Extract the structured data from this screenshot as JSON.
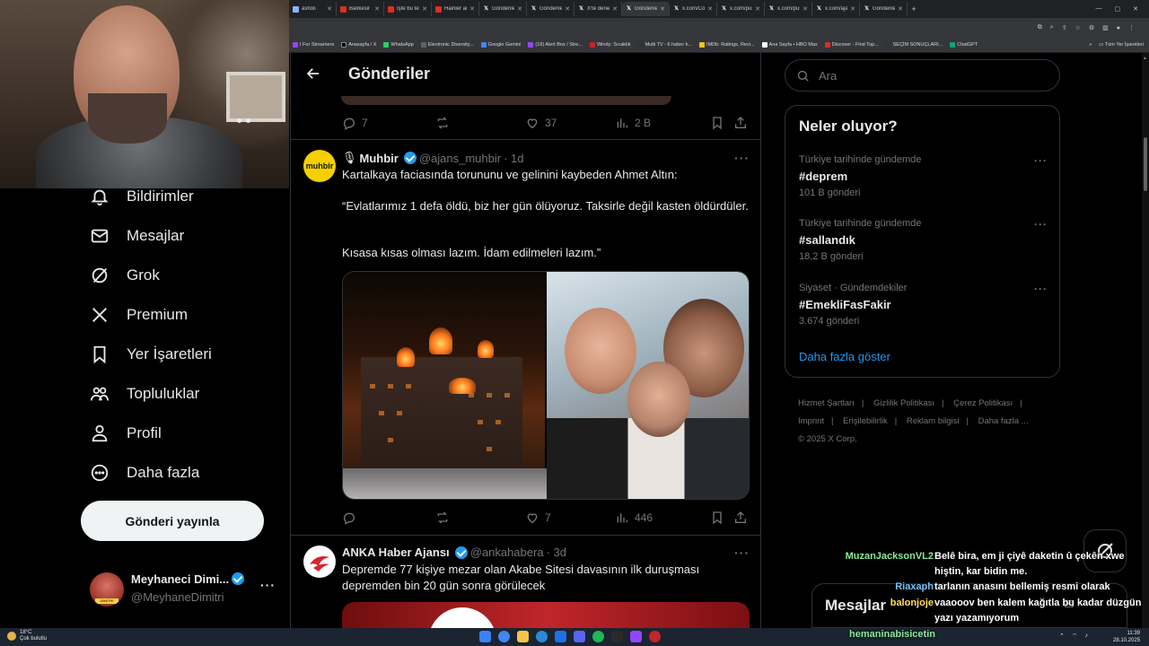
{
  "browser": {
    "tabs": [
      {
        "title": "asholi",
        "color": "#8ab4f8"
      },
      {
        "title": "Balıkesir Sar",
        "color": "#d93025"
      },
      {
        "title": "İşte bu tebr",
        "color": "#d93025"
      },
      {
        "title": "Hainler artık",
        "color": "#d93025"
      },
      {
        "title": "Gönderiler",
        "color": "#000000"
      },
      {
        "title": "Gönderiler",
        "color": "#000000"
      },
      {
        "title": "X'te denetim",
        "color": "#000000"
      },
      {
        "title": "Gönderiler",
        "color": "#000000",
        "active": true
      },
      {
        "title": "x.com/Com",
        "color": "#000000"
      },
      {
        "title": "x.com/push",
        "color": "#000000"
      },
      {
        "title": "x.com/push",
        "color": "#000000"
      },
      {
        "title": "x.com/ajans",
        "color": "#000000"
      },
      {
        "title": "Gönderiler",
        "color": "#000000"
      }
    ],
    "new_tab": "+",
    "bookmarks": [
      {
        "label": "t For Streamers",
        "color": "#9146ff"
      },
      {
        "label": "Anasayfa / X",
        "color": "#000000"
      },
      {
        "label": "WhatsApp",
        "color": "#25d366"
      },
      {
        "label": "Electronic Diversity...",
        "color": "#5f6368"
      },
      {
        "label": "Google Gemini",
        "color": "#4285f4"
      },
      {
        "label": "(19) Alert Box / Stre...",
        "color": "#9146ff"
      },
      {
        "label": "Windy: Sıcaklık",
        "color": "#c0262b"
      },
      {
        "label": "Multi TV - 6 haber k...",
        "color": "#333333"
      },
      {
        "label": "IMDb: Ratings, Revi...",
        "color": "#f5c518"
      },
      {
        "label": "Ana Sayfa • HBO Max",
        "color": "#ffffff"
      },
      {
        "label": "Discover - Find Top...",
        "color": "#d93025"
      },
      {
        "label": "SEÇİM SONUÇLARI...",
        "color": "#333333"
      },
      {
        "label": "ChatGPT",
        "color": "#10a37f"
      }
    ],
    "bookmarks_more": "»",
    "all_bookmarks": "Tüm Yer İşaretleri"
  },
  "leftnav": {
    "items": [
      {
        "label": "Bildirimler",
        "icon": "bell-icon"
      },
      {
        "label": "Mesajlar",
        "icon": "envelope-icon"
      },
      {
        "label": "Grok",
        "icon": "grok-icon"
      },
      {
        "label": "Premium",
        "icon": "x-logo-icon"
      },
      {
        "label": "Yer İşaretleri",
        "icon": "bookmark-icon"
      },
      {
        "label": "Topluluklar",
        "icon": "communities-icon"
      },
      {
        "label": "Profil",
        "icon": "person-icon"
      },
      {
        "label": "Daha fazla",
        "icon": "more-circle-icon"
      }
    ],
    "post_button": "Gönderi yayınla",
    "account": {
      "name": "Meyhaneci Dimi...",
      "handle": "@MeyhaneDimitri",
      "avatar_caption": "DİMİTRİ"
    }
  },
  "main": {
    "title": "Gönderiler",
    "prev_tweet_actions": {
      "replies": "7",
      "likes": "37",
      "views": "2 B"
    },
    "tweet1": {
      "name": "Muhbir",
      "handle": "@ajans_muhbir",
      "time": "· 1d",
      "avatar_text": "muhbir",
      "text1": "Kartalkaya faciasında torununu ve gelinini kaybeden Ahmet Altın:",
      "text2": "“Evlatlarımız 1 defa öldü, biz her gün ölüyoruz. Taksirle değil kasten öldürdüler.",
      "text3": "Kısasa kısas olması lazım. İdam edilmeleri lazım.”",
      "replies": "",
      "likes": "7",
      "views": "446"
    },
    "tweet2": {
      "name": "ANKA Haber Ajansı",
      "handle": "@ankahabera",
      "time": "· 3d",
      "text": "Depremde 77 kişiye mezar olan Akabe Sitesi davasının ilk duruşması depremden bin 20 gün sonra görülecek"
    }
  },
  "right": {
    "search_placeholder": "Ara",
    "trends_title": "Neler oluyor?",
    "trends": [
      {
        "category": "Türkiye tarihinde gündemde",
        "name": "#deprem",
        "count": "101 B gönderi"
      },
      {
        "category": "Türkiye tarihinde gündemde",
        "name": "#sallandık",
        "count": "18,2 B gönderi"
      },
      {
        "category": "Siyaset · Gündemdekiler",
        "name": "#EmekliFasFakir",
        "count": "3.674 gönderi"
      }
    ],
    "show_more": "Daha fazla göster",
    "footer": [
      "Hizmet Şartları",
      "Gizlilik Politikası",
      "Çerez Politikası",
      "Imprint",
      "Erişilebilirlik",
      "Reklam bilgisi",
      "Daha fazla ...",
      "© 2025 X Corp."
    ],
    "messages_drawer": "Mesajlar"
  },
  "chat": [
    {
      "user": "MuzanJacksonVL2",
      "color": "#8ce99a",
      "text": "Belê bira, em ji çiyê daketin û çekên xwe hiştin, kar bidin me."
    },
    {
      "user": "Riaxaph",
      "color": "#74c0fc",
      "text": "tarlanın anasını bellemiş resmi olarak"
    },
    {
      "user": "balonjoje",
      "color": "#ffe066",
      "text": "vaaooov ben kalem kağıtla bu kadar düzgün yazı yazamıyorum"
    },
    {
      "user": "hemaninabisicetin",
      "color": "#8ce99a",
      "text": ""
    }
  ],
  "taskbar": {
    "weather_temp": "18°C",
    "weather_desc": "Çok bulutlu",
    "time": "11:39",
    "date": "28.10.2025",
    "apps": [
      "#3b82f6",
      "#4285f4",
      "#f5c542",
      "#2b88d8",
      "#1f6feb",
      "#5865f2",
      "#1db954",
      "#2a2a2a",
      "#9146ff",
      "#c0262b"
    ]
  }
}
